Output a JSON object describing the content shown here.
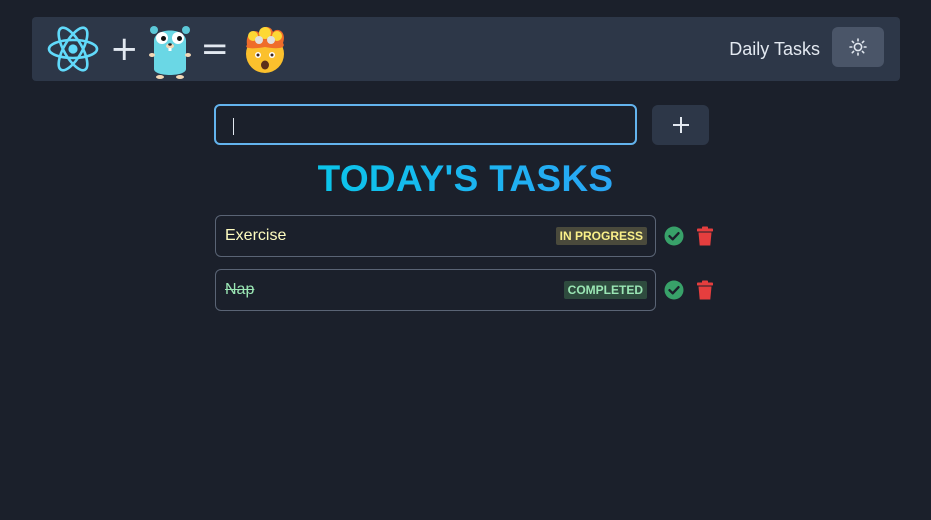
{
  "header": {
    "logo_plus": "+",
    "logo_equals": "=",
    "logo_icons": [
      "react-icon",
      "gopher-icon",
      "exploding-head-icon"
    ],
    "title": "Daily Tasks",
    "theme_toggle_icon": "sun-icon"
  },
  "input": {
    "value": "",
    "placeholder": ""
  },
  "add_button_icon": "plus-icon",
  "heading": "TODAY'S TASKS",
  "tasks": [
    {
      "name": "Exercise",
      "status": "IN PROGRESS",
      "complete_icon": "check-circle-icon",
      "delete_icon": "trash-icon"
    },
    {
      "name": "Nap",
      "status": "COMPLETED",
      "complete_icon": "check-circle-icon",
      "delete_icon": "trash-icon"
    }
  ],
  "colors": {
    "background": "#1b202b",
    "navbar": "#2d3748",
    "accent": "#0bc5ea",
    "input_border": "#63b3ed",
    "in_progress": "#faf089",
    "completed": "#9ae6b4",
    "check": "#38a169",
    "delete": "#e53e3e"
  }
}
